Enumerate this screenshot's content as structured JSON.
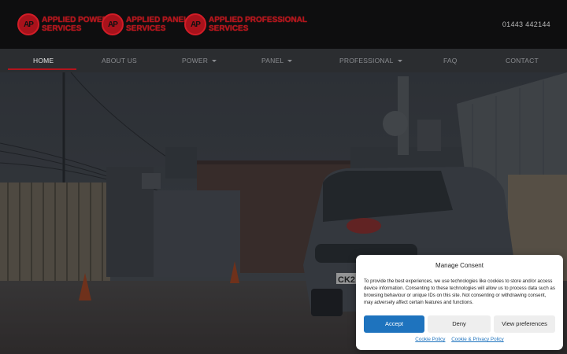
{
  "header": {
    "logos": [
      {
        "mark": "AP",
        "line1": "APPLIED POWER",
        "line2": "SERVICES"
      },
      {
        "mark": "AP",
        "line1": "APPLIED PANEL",
        "line2": "SERVICES"
      },
      {
        "mark": "AP",
        "line1": "APPLIED PROFESSIONAL",
        "line2": "SERVICES"
      }
    ],
    "phone": "01443 442144"
  },
  "nav": {
    "items": [
      {
        "label": "HOME",
        "active": true
      },
      {
        "label": "ABOUT US"
      },
      {
        "label": "POWER",
        "dropdown": true
      },
      {
        "label": "PANEL",
        "dropdown": true
      },
      {
        "label": "PROFESSIONAL",
        "dropdown": true
      },
      {
        "label": "FAQ"
      },
      {
        "label": "CONTACT"
      }
    ]
  },
  "hero": {
    "van_plate": "CK2"
  },
  "consent": {
    "title": "Manage Consent",
    "body": "To provide the best experiences, we use technologies like cookies to store and/or access device information. Consenting to these technologies will allow us to process data such as browsing behaviour or unique IDs on this site. Not consenting or withdrawing consent, may adversely affect certain features and functions.",
    "accept": "Accept",
    "deny": "Deny",
    "preferences": "View preferences",
    "cookie_policy": "Cookie Policy",
    "privacy_policy": "Cookie & Privacy Policy"
  },
  "colors": {
    "brand_red": "#b3141c",
    "accept_blue": "#1e73be"
  }
}
